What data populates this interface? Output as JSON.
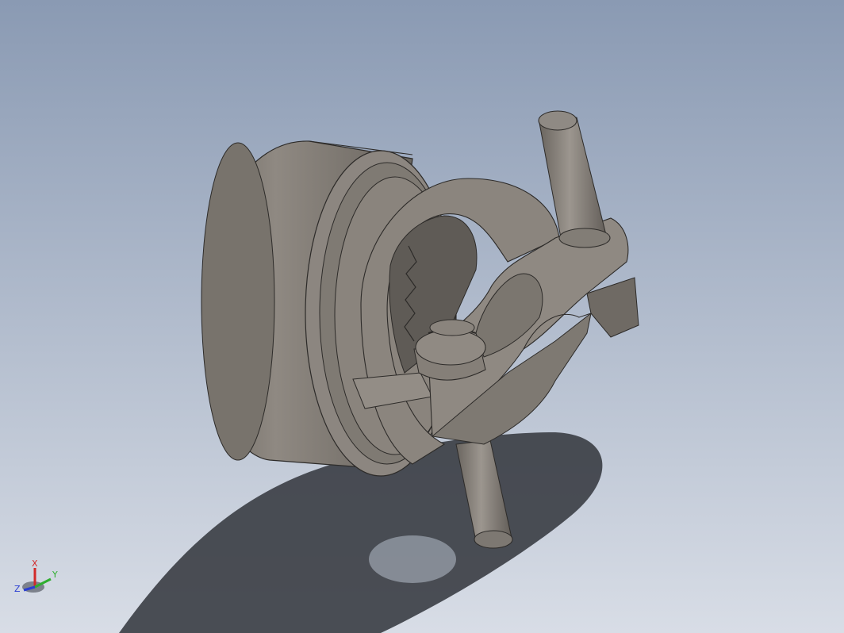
{
  "viewport": {
    "background_top": "#8a9ab3",
    "background_bottom": "#d8dde6",
    "model_color": "#8d877f",
    "shadow_color": "#3c3f46"
  },
  "triad": {
    "x_label": "X",
    "y_label": "Y",
    "z_label": "Z",
    "x_color": "#d22a2a",
    "y_color": "#2fae2f",
    "z_color": "#2a3ed2"
  }
}
